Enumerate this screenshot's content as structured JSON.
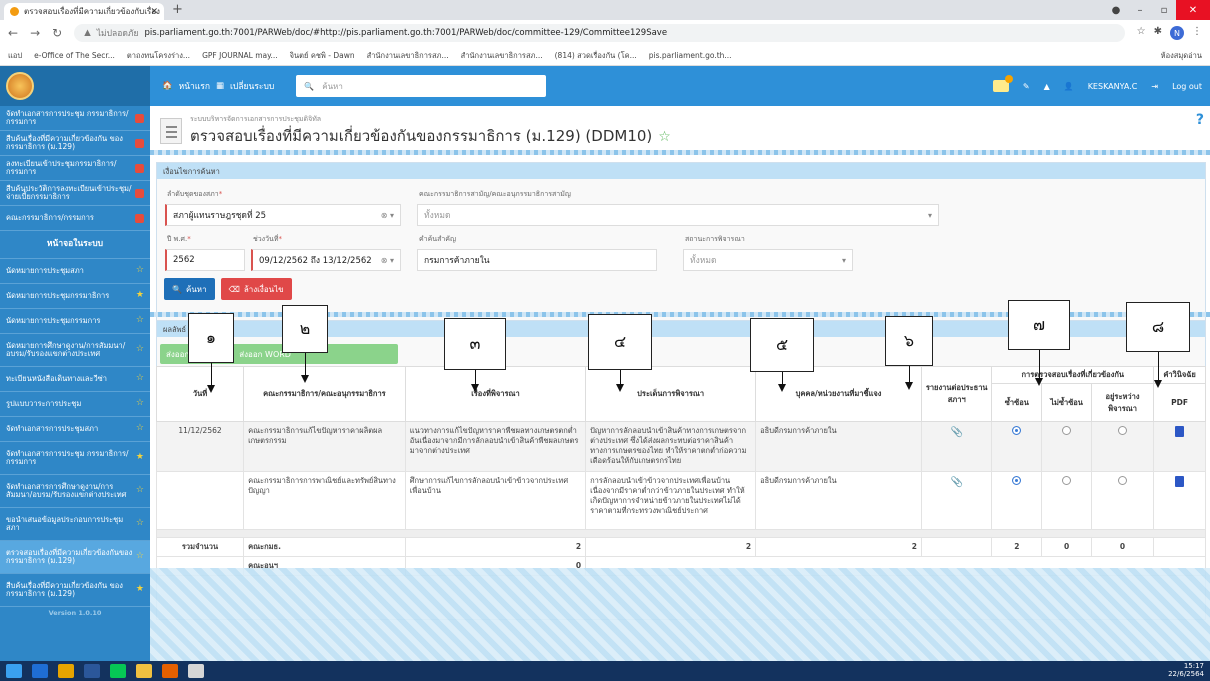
{
  "browser": {
    "tab_title": "ตรวจสอบเรื่องที่มีความเกี่ยวข้องกับเรื่อง",
    "url_security": "ไม่ปลอดภัย",
    "url": "pis.parliament.go.th:7001/PARWeb/doc/#http://pis.parliament.go.th:7001/PARWeb/doc/committee-129/Committee129Save",
    "profile": "N"
  },
  "bookmarks": [
    "แอป",
    "e-Office of The Secr...",
    "ตาถงทนโครงร่าง...",
    "GPF JOURNAL may...",
    "จินตย์ คชพิ - Dawn",
    "สำนักงานเลขาธิการสภ...",
    "สำนักงานเลขาธิการสภ...",
    "(814) สวดเรื่องกัน (โค...",
    "pis.parliament.go.th..."
  ],
  "bookmarks_right": "ห้องสมุดอ่าน",
  "header": {
    "home": "หน้าแรก",
    "change_system": "เปลี่ยนระบบ",
    "search_placeholder": "ค้นหา",
    "user": "KESKANYA.C",
    "logout": "Log out"
  },
  "sidebar": {
    "items_top": [
      "จัดทำเอกสารการประชุม กรรมาธิการ/กรรมการ",
      "สืบค้นเรื่องที่มีความเกี่ยวข้องกัน ของกรรมาธิการ (ม.129)",
      "ลงทะเบียนเข้าประชุมกรรมาธิการ/กรรมการ",
      "สืบค้นประวัติการลงทะเบียนเข้าประชุม/จ่ายเบี้ยกรรมาธิการ",
      "คณะกรรมาธิการ/กรรมการ"
    ],
    "section": "หน้าจอในระบบ",
    "items": [
      "นัดหมายการประชุมสภา",
      "นัดหมายการประชุมกรรมาธิการ",
      "นัดหมายการประชุมกรรมการ",
      "นัดหมายการศึกษาดูงาน/การสัมมนา/อบรม/รับรองแขกต่างประเทศ",
      "ทะเบียนหนังสือเดินทางและวีซ่า",
      "รูปแบบวาระการประชุม",
      "จัดทำเอกสารการประชุมสภา",
      "จัดทำเอกสารการประชุม กรรมาธิการ/กรรมการ",
      "จัดทำเอกสารการศึกษาดูงาน/การสัมมนา/อบรม/รับรองแขกต่างประเทศ",
      "ขอนำเสนอข้อมูลประกอบการประชุมสภา",
      "ตรวจสอบเรื่องที่มีความเกี่ยวข้องกันของกรรมาธิการ (ม.129)",
      "สืบค้นเรื่องที่มีความเกี่ยวข้องกัน ของกรรมาธิการ (ม.129)"
    ],
    "version": "Version 1.0.10"
  },
  "page": {
    "breadcrumb": "ระบบบริหารจัดการเอกสารการประชุมดิจิทัล",
    "title": "ตรวจสอบเรื่องที่มีความเกี่ยวข้องกันของกรรมาธิการ (ม.129) (DDM10)",
    "help": "?"
  },
  "search": {
    "panel_title": "เงื่อนไขการค้นหา",
    "session_label": "ลำดับชุดของสภา",
    "session_value": "สภาผู้แทนราษฎรชุดที่ 25",
    "committee_label": "คณะกรรมาธิการสามัญ/คณะอนุกรรมาธิการสามัญ",
    "committee_value": "ทั้งหมด",
    "year_label": "ปี พ.ศ.",
    "year_value": "2562",
    "range_label": "ช่วงวันที่",
    "range_value": "09/12/2562 ถึง 13/12/2562",
    "keyword_label": "คำค้นสำคัญ",
    "keyword_value": "กรมการค้าภายใน",
    "status_label": "สถานะการพิจารณา",
    "status_value": "ทั้งหมด",
    "search_btn": "ค้นหา",
    "clear_btn": "ล้างเงื่อนไข"
  },
  "results": {
    "title": "ผลลัพธ์",
    "export_excel": "ส่งออก",
    "export_word": "ส่งออก WORD",
    "headers": {
      "date": "วันที่",
      "committee": "คณะกรรมาธิการ/คณะอนุกรรมาธิการ",
      "subject": "เรื่องที่พิจารณา",
      "issue": "ประเด็นการพิจารณา",
      "person": "บุคคล/หน่วยงานที่มาชี้แจง",
      "report": "รายงานต่อประธานสภาฯ",
      "check_group": "การตรวจสอบเรื่องที่เกี่ยวข้องกัน",
      "dup": "ซ้ำซ้อน",
      "nodup": "ไม่ซ้ำซ้อน",
      "pending": "อยู่ระหว่างพิจารณา",
      "attach": "คำวินิจฉัย",
      "pdf": "PDF"
    },
    "rows": [
      {
        "date": "11/12/2562",
        "committee": "คณะกรรมาธิการแก้ไขปัญหาราคาผลิตผลเกษตรกรรม",
        "subject": "แนวทางการแก้ไขปัญหาราคาพืชผลทางเกษตรตกต่ำอันเนื่องมาจากมีการลักลอบนำเข้าสินค้าพืชผลเกษตรมาจากต่างประเทศ",
        "issue": "ปัญหาการลักลอบนำเข้าสินค้าทางการเกษตรจากต่างประเทศ ซึ่งได้ส่งผลกระทบต่อราคาสินค้าทางการเกษตรของไทย ทำให้ราคาตกต่ำก่อความเดือดร้อนให้กับเกษตรกรไทย",
        "person": "อธิบดีกรมการค้าภายใน"
      },
      {
        "date": "",
        "committee": "คณะกรรมาธิการการพาณิชย์และทรัพย์สินทางปัญญา",
        "subject": "ศึกษาการแก้ไขการลักลอบนำเข้าข้าวจากประเทศเพื่อนบ้าน",
        "issue": "การลักลอบนำเข้าข้าวจากประเทศเพื่อนบ้าน เนื่องจากมีราคาต่ำกว่าข้าวภายในประเทศ ทำให้เกิดปัญหาการจำหน่ายข้าวภายในประเทศไม่ได้ราคาตามที่กระทรวงพาณิชย์ประกาศ",
        "person": "อธิบดีกรมการค้าภายใน"
      }
    ],
    "summary": {
      "label": "รวมจำนวน",
      "committee_label": "คณะกมธ.",
      "sub_label": "คณะอนุฯ",
      "v_subject": "2",
      "v_issue": "2",
      "v_person": "2",
      "v_dup": "2",
      "v_nodup": "0",
      "v_pending": "0",
      "v_sub": "0"
    }
  },
  "annotations": [
    "๑",
    "๒",
    "๓",
    "๔",
    "๕",
    "๖",
    "๗",
    "๘"
  ],
  "taskbar": {
    "time": "15:17",
    "date": "22/6/2564"
  }
}
